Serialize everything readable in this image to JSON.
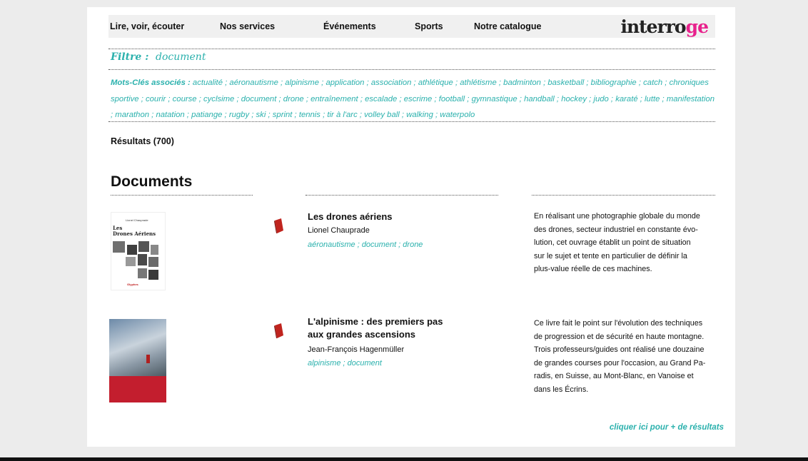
{
  "nav": {
    "items": [
      "Lire, voir, écouter",
      "Nos services",
      "Événements",
      "Sports",
      "Notre catalogue"
    ],
    "logo_main": "interro",
    "logo_accent": "ge"
  },
  "filter": {
    "label": "Filtre :",
    "value": "document"
  },
  "keywords": {
    "label": "Mots-Clés associés :",
    "items": [
      "actualité",
      "aéronautisme",
      "alpinisme",
      "application",
      "association",
      "athlétique",
      "athlétisme",
      "badminton",
      "basketball",
      "bibliographie",
      "catch",
      "chroniques sportive",
      "courir",
      "course",
      "cyclsime",
      "document",
      "drone",
      "entraînement",
      "escalade",
      "escrime",
      "football",
      "gymnastique",
      "handball",
      "hockey",
      "judo",
      "karaté",
      "lutte",
      "manifestation",
      "marathon",
      "natation",
      "patiange",
      "rugby",
      "ski",
      "sprint",
      "tennis",
      "tir à l'arc",
      "volley ball",
      "walking",
      "waterpolo"
    ]
  },
  "results": {
    "label": "Résultats (700)"
  },
  "section": {
    "title": "Documents"
  },
  "documents": [
    {
      "cover_author": "Lionel Chauprade",
      "cover_title_line1": "Les",
      "cover_title_line2": "Drones Aériens",
      "cover_publisher": "Glyphes",
      "title_lines": [
        "Les drones aériens"
      ],
      "author": "Lionel Chauprade",
      "tags": "aéronautisme ; document ; drone",
      "description_lines": [
        "En réalisant une photographie globale du monde",
        "des drones, secteur industriel en constante évo-",
        "lution, cet ouvrage établit un point de situation",
        "sur le sujet et tente en particulier de définir la",
        "plus-value réelle de ces machines."
      ]
    },
    {
      "title_lines": [
        "L'alpinisme : des premiers pas",
        "aux grandes ascensions"
      ],
      "author": "Jean-François Hagenmüller",
      "tags": "alpinisme ; document",
      "description_lines": [
        "Ce livre fait le point sur l'évolution des techniques",
        "de progression et de sécurité en haute montagne.",
        "Trois professeurs/guides ont réalisé une douzaine",
        "de grandes courses pour l'occasion, au Grand Pa-",
        "radis, en Suisse, au Mont-Blanc, en Vanoise et",
        "dans les Écrins."
      ]
    }
  ],
  "more_link": "cliquer ici pour + de résultats",
  "colors": {
    "accent": "#2bb1ad",
    "logo_pink": "#e8218c",
    "book_red": "#c0241e"
  }
}
